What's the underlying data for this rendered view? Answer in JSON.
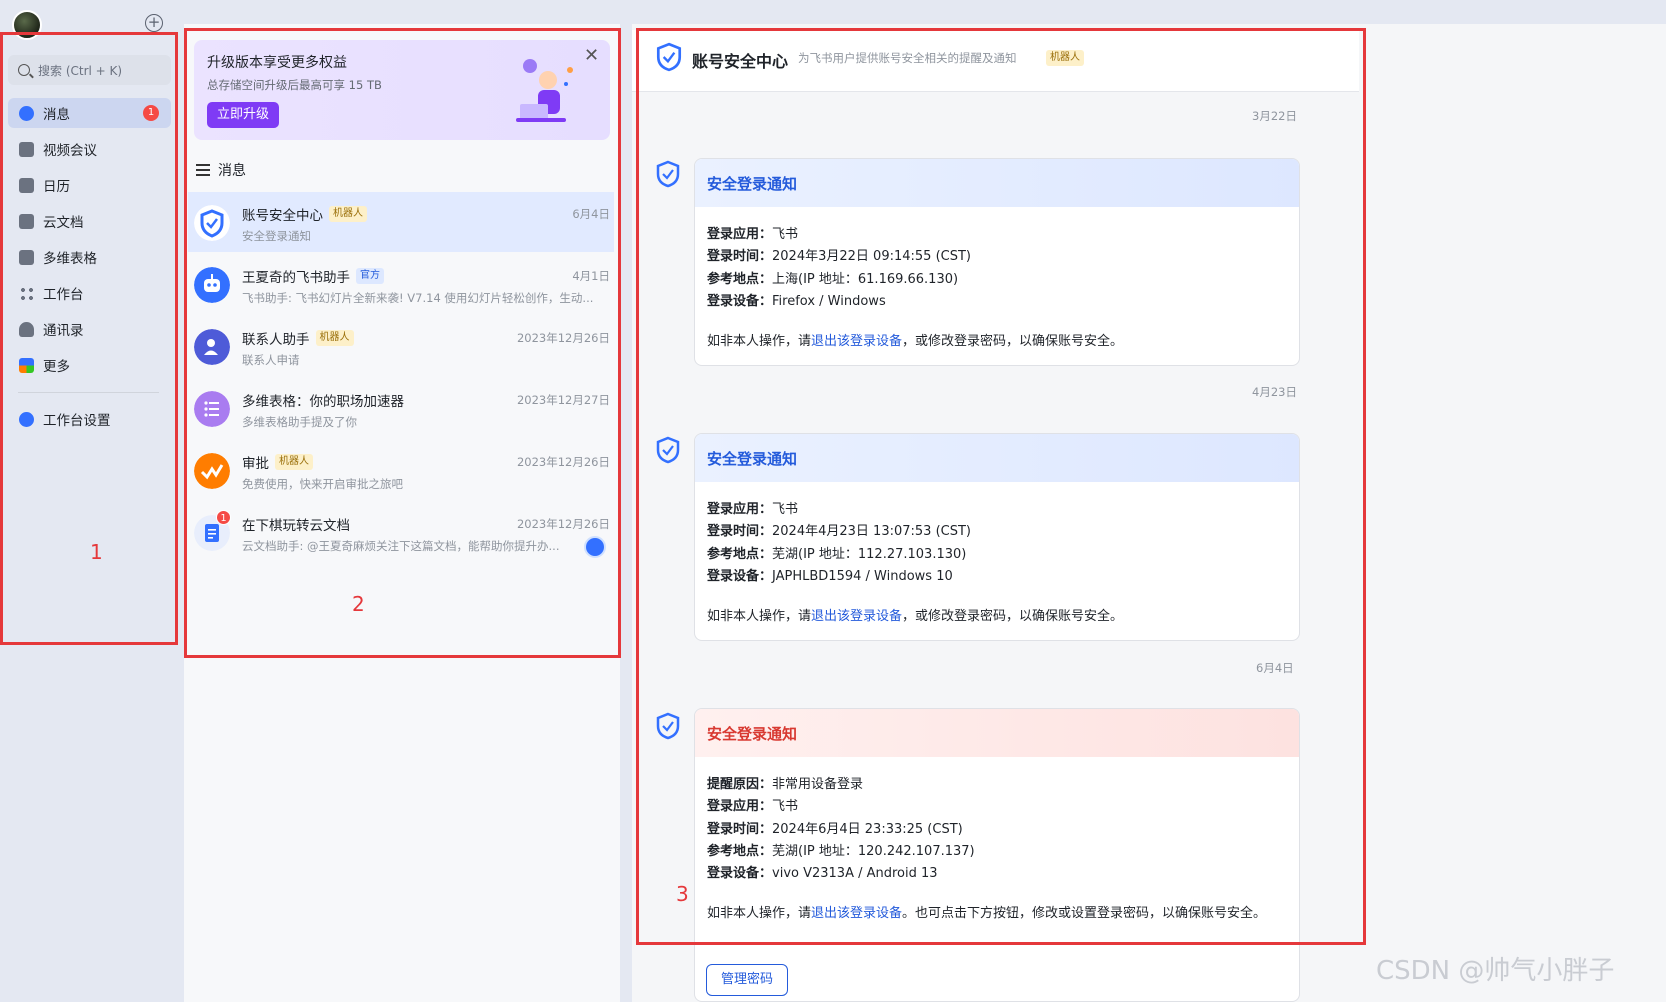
{
  "sidebar": {
    "search_placeholder": "搜索 (Ctrl + K)",
    "add_icon": "plus-circle-icon",
    "items": [
      {
        "label": "消息",
        "icon": "chat-bubble-icon",
        "badge": "1",
        "active": true
      },
      {
        "label": "视频会议",
        "icon": "video-camera-icon"
      },
      {
        "label": "日历",
        "icon": "calendar-icon"
      },
      {
        "label": "云文档",
        "icon": "cloud-doc-icon"
      },
      {
        "label": "多维表格",
        "icon": "table-icon"
      },
      {
        "label": "工作台",
        "icon": "grid-icon"
      },
      {
        "label": "通讯录",
        "icon": "contacts-icon"
      },
      {
        "label": "更多",
        "icon": "more-apps-icon"
      }
    ],
    "settings_label": "工作台设置"
  },
  "upgrade": {
    "title": "升级版本享受更多权益",
    "subtitle": "总存储空间升级后最高可享 15 TB",
    "button": "立即升级"
  },
  "chat_list": {
    "header": "消息",
    "chats": [
      {
        "name": "账号安全中心",
        "tag": "机器人",
        "time": "6月4日",
        "preview": "安全登录通知"
      },
      {
        "name": "王夏奇的飞书助手",
        "tag": "官方",
        "time": "4月1日",
        "preview": "飞书助手: 飞书幻灯片全新来袭! V7.14 使用幻灯片轻松创作，生动..."
      },
      {
        "name": "联系人助手",
        "tag": "机器人",
        "time": "2023年12月26日",
        "preview": "联系人申请"
      },
      {
        "name": "多维表格：你的职场加速器",
        "tag": "",
        "time": "2023年12月27日",
        "preview": "多维表格助手提及了你"
      },
      {
        "name": "审批",
        "tag": "机器人",
        "time": "2023年12月26日",
        "preview": "免费使用，快来开启审批之旅吧"
      },
      {
        "name": "在下棋玩转云文档",
        "tag": "",
        "time": "2023年12月26日",
        "preview": "云文档助手: @王夏奇麻烦关注下这篇文档，能帮助你提升办...",
        "badge": "1"
      }
    ]
  },
  "chat_detail": {
    "title": "账号安全中心",
    "description": "为飞书用户提供账号安全相关的提醒及通知",
    "tag": "机器人",
    "messages": [
      {
        "date": "3月22日",
        "title": "安全登录通知",
        "rows": [
          {
            "label": "登录应用：",
            "value": "飞书"
          },
          {
            "label": "登录时间：",
            "value": "2024年3月22日 09:14:55 (CST)"
          },
          {
            "label": "参考地点：",
            "value": "上海(IP 地址：61.169.66.130)"
          },
          {
            "label": "登录设备：",
            "value": "Firefox / Windows"
          }
        ],
        "foot_pre": "如非本人操作，请",
        "foot_link": "退出该登录设备",
        "foot_post": "，或修改登录密码，以确保账号安全。"
      },
      {
        "date": "4月23日",
        "title": "安全登录通知",
        "rows": [
          {
            "label": "登录应用：",
            "value": "飞书"
          },
          {
            "label": "登录时间：",
            "value": "2024年4月23日 13:07:53 (CST)"
          },
          {
            "label": "参考地点：",
            "value": "芜湖(IP 地址：112.27.103.130)"
          },
          {
            "label": "登录设备：",
            "value": "JAPHLBD1594 / Windows 10"
          }
        ],
        "foot_pre": "如非本人操作，请",
        "foot_link": "退出该登录设备",
        "foot_post": "，或修改登录密码，以确保账号安全。"
      },
      {
        "date": "6月4日",
        "title": "安全登录通知",
        "rows": [
          {
            "label": "提醒原因：",
            "value": "非常用设备登录"
          },
          {
            "label": "登录应用：",
            "value": "飞书"
          },
          {
            "label": "登录时间：",
            "value": "2024年6月4日 23:33:25 (CST)"
          },
          {
            "label": "参考地点：",
            "value": "芜湖(IP 地址：120.242.107.137)"
          },
          {
            "label": "登录设备：",
            "value": "vivo V2313A / Android 13"
          }
        ],
        "foot_pre": "如非本人操作，请",
        "foot_link": "退出该登录设备",
        "foot_post": "。也可点击下方按钮，修改或设置登录密码，以确保账号安全。",
        "button": "管理密码"
      }
    ]
  },
  "annotations": {
    "label1": "1",
    "label2": "2",
    "label3": "3"
  },
  "watermark": "CSDN @帅气小胖子",
  "colors": {
    "accent": "#245bdb",
    "upgrade_button": "#7f3bf5",
    "warning_title": "#d83931",
    "annotation_red": "#e5383b"
  }
}
